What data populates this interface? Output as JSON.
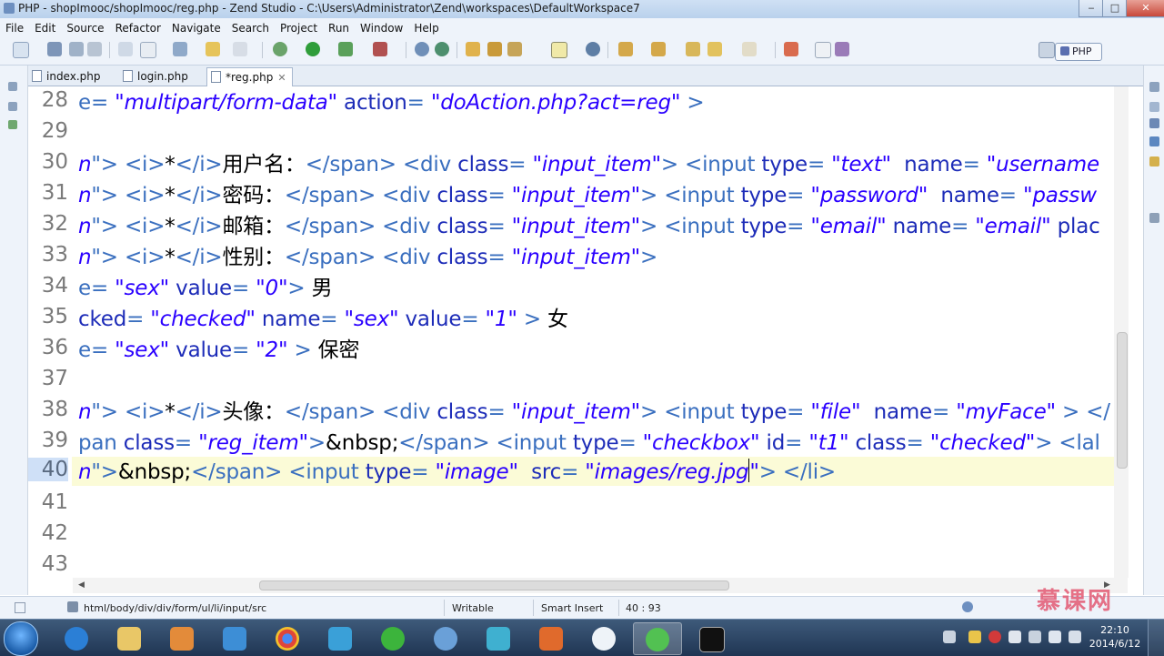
{
  "window": {
    "title": "PHP - shopImooc/shopImooc/reg.php - Zend Studio - C:\\Users\\Administrator\\Zend\\workspaces\\DefaultWorkspace7",
    "controls": [
      "‒",
      "□",
      "✕"
    ]
  },
  "menu": [
    "File",
    "Edit",
    "Source",
    "Refactor",
    "Navigate",
    "Search",
    "Project",
    "Run",
    "Window",
    "Help"
  ],
  "perspective": {
    "label": "PHP"
  },
  "tabs": [
    {
      "label": "index.php",
      "active": false
    },
    {
      "label": "login.php",
      "active": false
    },
    {
      "label": "*reg.php",
      "active": true,
      "close": "✕"
    }
  ],
  "editor": {
    "line_numbers": [
      "28",
      "29",
      "30",
      "31",
      "32",
      "33",
      "34",
      "35",
      "36",
      "37",
      "38",
      "39",
      "40",
      "41",
      "42",
      "43"
    ],
    "current_line": "40",
    "lines": {
      "l28": [
        [
          "t",
          "e= "
        ],
        [
          "s",
          "\"multipart/form-data\""
        ],
        [
          "a",
          " action"
        ],
        [
          "t",
          "= "
        ],
        [
          "s",
          "\"doAction.php?act=reg\""
        ],
        [
          "t",
          " >"
        ]
      ],
      "l30": [
        [
          "s",
          "n"
        ],
        [
          "t",
          "\"> <i>"
        ],
        [
          "x",
          "*"
        ],
        [
          "t",
          "</i>"
        ],
        [
          "x",
          "用户名："
        ],
        [
          "t",
          "</span> <div "
        ],
        [
          "a",
          "class"
        ],
        [
          "t",
          "= "
        ],
        [
          "s",
          "\"input_item\""
        ],
        [
          "t",
          "> <input "
        ],
        [
          "a",
          "type"
        ],
        [
          "t",
          "= "
        ],
        [
          "s",
          "\"text\""
        ],
        [
          "a",
          "  name"
        ],
        [
          "t",
          "= "
        ],
        [
          "s",
          "\"username"
        ]
      ],
      "l31": [
        [
          "s",
          "n"
        ],
        [
          "t",
          "\"> <i>"
        ],
        [
          "x",
          "*"
        ],
        [
          "t",
          "</i>"
        ],
        [
          "x",
          "密码："
        ],
        [
          "t",
          "</span> <div "
        ],
        [
          "a",
          "class"
        ],
        [
          "t",
          "= "
        ],
        [
          "s",
          "\"input_item\""
        ],
        [
          "t",
          "> <input "
        ],
        [
          "a",
          "type"
        ],
        [
          "t",
          "= "
        ],
        [
          "s",
          "\"password\""
        ],
        [
          "a",
          "  name"
        ],
        [
          "t",
          "= "
        ],
        [
          "s",
          "\"passw"
        ]
      ],
      "l32": [
        [
          "s",
          "n"
        ],
        [
          "t",
          "\"> <i>"
        ],
        [
          "x",
          "*"
        ],
        [
          "t",
          "</i>"
        ],
        [
          "x",
          "邮箱："
        ],
        [
          "t",
          "</span> <div "
        ],
        [
          "a",
          "class"
        ],
        [
          "t",
          "= "
        ],
        [
          "s",
          "\"input_item\""
        ],
        [
          "t",
          "> <input "
        ],
        [
          "a",
          "type"
        ],
        [
          "t",
          "= "
        ],
        [
          "s",
          "\"email\""
        ],
        [
          "a",
          " name"
        ],
        [
          "t",
          "= "
        ],
        [
          "s",
          "\"email\""
        ],
        [
          "a",
          " plac"
        ]
      ],
      "l33": [
        [
          "s",
          "n"
        ],
        [
          "t",
          "\"> <i>"
        ],
        [
          "x",
          "*"
        ],
        [
          "t",
          "</i>"
        ],
        [
          "x",
          "性别："
        ],
        [
          "t",
          "</span> <div "
        ],
        [
          "a",
          "class"
        ],
        [
          "t",
          "= "
        ],
        [
          "s",
          "\"input_item\""
        ],
        [
          "t",
          ">"
        ]
      ],
      "l34": [
        [
          "t",
          "e= "
        ],
        [
          "s",
          "\"sex\""
        ],
        [
          "a",
          " value"
        ],
        [
          "t",
          "= "
        ],
        [
          "s",
          "\"0\""
        ],
        [
          "t",
          "> "
        ],
        [
          "x",
          "男"
        ]
      ],
      "l35": [
        [
          "a",
          "cked"
        ],
        [
          "t",
          "= "
        ],
        [
          "s",
          "\"checked\""
        ],
        [
          "a",
          " name"
        ],
        [
          "t",
          "= "
        ],
        [
          "s",
          "\"sex\""
        ],
        [
          "a",
          " value"
        ],
        [
          "t",
          "= "
        ],
        [
          "s",
          "\"1\""
        ],
        [
          "t",
          " > "
        ],
        [
          "x",
          "女"
        ]
      ],
      "l36": [
        [
          "t",
          "e= "
        ],
        [
          "s",
          "\"sex\""
        ],
        [
          "a",
          " value"
        ],
        [
          "t",
          "= "
        ],
        [
          "s",
          "\"2\""
        ],
        [
          "t",
          " > "
        ],
        [
          "x",
          "保密"
        ]
      ],
      "l38": [
        [
          "s",
          "n"
        ],
        [
          "t",
          "\"> <i>"
        ],
        [
          "x",
          "*"
        ],
        [
          "t",
          "</i>"
        ],
        [
          "x",
          "头像："
        ],
        [
          "t",
          "</span> <div "
        ],
        [
          "a",
          "class"
        ],
        [
          "t",
          "= "
        ],
        [
          "s",
          "\"input_item\""
        ],
        [
          "t",
          "> <input "
        ],
        [
          "a",
          "type"
        ],
        [
          "t",
          "= "
        ],
        [
          "s",
          "\"file\""
        ],
        [
          "a",
          "  name"
        ],
        [
          "t",
          "= "
        ],
        [
          "s",
          "\"myFace\""
        ],
        [
          "t",
          " > </"
        ]
      ],
      "l39": [
        [
          "t",
          "pan "
        ],
        [
          "a",
          "class"
        ],
        [
          "t",
          "= "
        ],
        [
          "s",
          "\"reg_item\""
        ],
        [
          "t",
          ">"
        ],
        [
          "x",
          "&nbsp;"
        ],
        [
          "t",
          "</span> <input "
        ],
        [
          "a",
          "type"
        ],
        [
          "t",
          "= "
        ],
        [
          "s",
          "\"checkbox\""
        ],
        [
          "a",
          " id"
        ],
        [
          "t",
          "= "
        ],
        [
          "s",
          "\"t1\""
        ],
        [
          "a",
          " class"
        ],
        [
          "t",
          "= "
        ],
        [
          "s",
          "\"checked\""
        ],
        [
          "t",
          "> <lal"
        ]
      ],
      "l40": [
        [
          "s",
          "n"
        ],
        [
          "t",
          "\">"
        ],
        [
          "x",
          "&nbsp;"
        ],
        [
          "t",
          "</span> <input "
        ],
        [
          "a",
          "type"
        ],
        [
          "t",
          "= "
        ],
        [
          "s",
          "\"image\""
        ],
        [
          "a",
          "  src"
        ],
        [
          "t",
          "= "
        ],
        [
          "s",
          "\"images/reg.jpg"
        ],
        [
          "caret",
          ""
        ],
        [
          "s",
          "\""
        ],
        [
          "t",
          "> </li>"
        ]
      ]
    }
  },
  "status": {
    "path": "html/body/div/div/form/ul/li/input/src",
    "mode": "Writable",
    "insert": "Smart Insert",
    "position": "40 : 93",
    "watermark": "慕课网"
  },
  "taskbar": {
    "time": "22:10",
    "date": "2014/6/12",
    "apps": [
      "internet-explorer",
      "file-explorer",
      "media-player",
      "zend-studio",
      "chrome",
      "network-app",
      "green-ball-app",
      "chat-app",
      "cloud-app",
      "pdf-app",
      "messenger-app",
      "green-app-active",
      "command-prompt"
    ]
  },
  "colors": {
    "tag": "#3a6fbf",
    "attribute": "#1d2cb8",
    "string": "#2a00ff",
    "current_line": "#fbfbd7"
  }
}
